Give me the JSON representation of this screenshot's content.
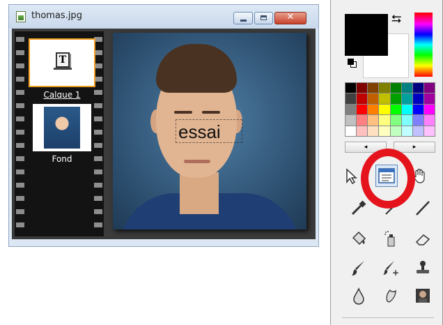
{
  "window": {
    "title": "thomas.jpg"
  },
  "layers": [
    {
      "label": "Calque 1",
      "type": "text-layer",
      "icon": "text-layer-icon",
      "selected": true
    },
    {
      "label": "Fond",
      "type": "image-layer",
      "icon": "portrait-thumbnail",
      "selected": false
    }
  ],
  "canvas": {
    "overlay_text": "essai"
  },
  "colors": {
    "foreground": "#000000",
    "background": "#ffffff",
    "selection_highlight": "#e5141c",
    "layer_selected_border": "#f0a020"
  },
  "palette": [
    "#000000",
    "#800000",
    "#804000",
    "#808000",
    "#008000",
    "#008080",
    "#000080",
    "#800080",
    "#404040",
    "#c00000",
    "#c06000",
    "#c0c000",
    "#00a000",
    "#00a0a0",
    "#0000c0",
    "#a000a0",
    "#808080",
    "#ff0000",
    "#ff8000",
    "#ffff00",
    "#00ff00",
    "#00ffff",
    "#0000ff",
    "#ff00ff",
    "#c0c0c0",
    "#ff8080",
    "#ffc080",
    "#ffff80",
    "#80ff80",
    "#80ffff",
    "#8080ff",
    "#ff80ff",
    "#ffffff",
    "#ffc0c0",
    "#ffe0c0",
    "#ffffc0",
    "#c0ffc0",
    "#c0ffff",
    "#c0c0ff",
    "#ffc0ff"
  ],
  "palette_scroll": {
    "left": "◂",
    "right": "▸"
  },
  "swap_glyph": "⮀",
  "tools": [
    {
      "name": "move-icon",
      "row": 0,
      "col": 0
    },
    {
      "name": "text-frame-icon",
      "row": 0,
      "col": 1,
      "active": true
    },
    {
      "name": "hand-icon",
      "row": 0,
      "col": 2
    },
    {
      "name": "eyedropper-icon",
      "row": 1,
      "col": 0
    },
    {
      "name": "magic-wand-icon",
      "row": 1,
      "col": 1
    },
    {
      "name": "line-icon",
      "row": 1,
      "col": 2
    },
    {
      "name": "paint-bucket-icon",
      "row": 2,
      "col": 0
    },
    {
      "name": "spray-can-icon",
      "row": 2,
      "col": 1
    },
    {
      "name": "eraser-icon",
      "row": 2,
      "col": 2
    },
    {
      "name": "brush-icon",
      "row": 3,
      "col": 0
    },
    {
      "name": "brush-plus-icon",
      "row": 3,
      "col": 1
    },
    {
      "name": "clone-stamp-icon",
      "row": 3,
      "col": 2
    },
    {
      "name": "drop-icon",
      "row": 4,
      "col": 0
    },
    {
      "name": "smudge-icon",
      "row": 4,
      "col": 1
    },
    {
      "name": "portrait-icon",
      "row": 4,
      "col": 2
    }
  ]
}
